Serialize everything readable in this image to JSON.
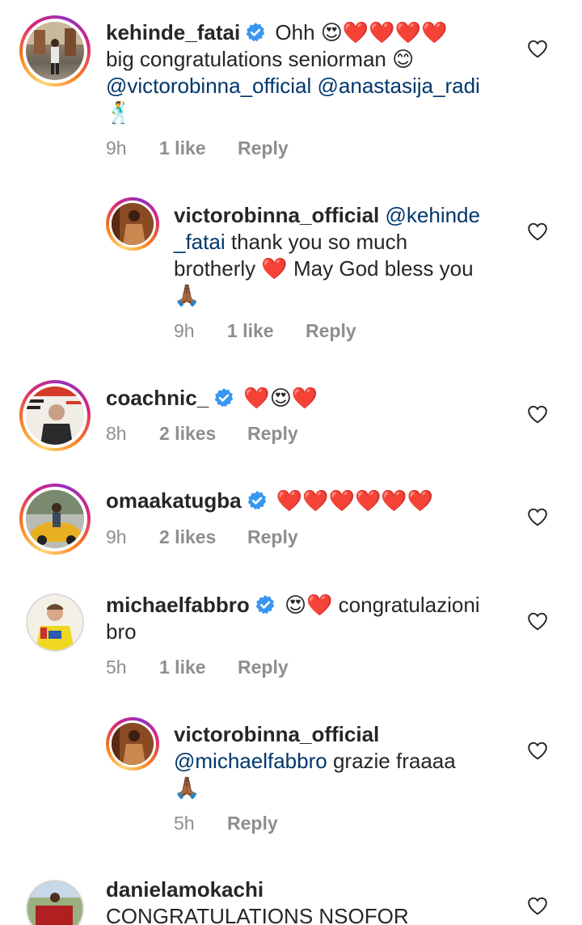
{
  "comments": [
    {
      "username": "kehinde_fatai",
      "verified": true,
      "text_a": "Ohh",
      "emojis_a": "😍❤️❤️❤️❤️",
      "text_b": "big congratulations seniorman",
      "emoji_b": "😊",
      "mention_1": "@victorobinna_official",
      "mention_2": "@anastasija_radi",
      "emoji_c": "🕺",
      "time": "9h",
      "likes": "1 like",
      "reply": "Reply"
    },
    {
      "username": "victorobinna_official",
      "mention_a": "@kehinde",
      "mention_b": "_fatai",
      "text_a": "thank you so much",
      "text_b": "brotherly",
      "heart": "❤️",
      "text_c": "May God bless you",
      "emoji": "🙏🏾",
      "time": "9h",
      "likes": "1 like",
      "reply": "Reply"
    },
    {
      "username": "coachnic_",
      "verified": true,
      "emojis": "❤️😍❤️",
      "time": "8h",
      "likes": "2 likes",
      "reply": "Reply"
    },
    {
      "username": "omaakatugba",
      "verified": true,
      "emojis": "❤️❤️❤️❤️❤️❤️",
      "time": "9h",
      "likes": "2 likes",
      "reply": "Reply"
    },
    {
      "username": "michaelfabbro",
      "verified": true,
      "emojis": "😍❤️",
      "text_a": "congratulazioni",
      "text_b": "bro",
      "time": "5h",
      "likes": "1 like",
      "reply": "Reply"
    },
    {
      "username": "victorobinna_official",
      "mention": "@michaelfabbro",
      "text_a": "grazie fraaaa",
      "emoji": "🙏🏾",
      "time": "5h",
      "reply": "Reply"
    },
    {
      "username": "danielamokachi",
      "text_a": "CONGRATULATIONS NSOFOR"
    }
  ],
  "colors": {
    "verified": "#3897f0",
    "mention": "#00376b",
    "meta": "#8e8e8e"
  },
  "icons": {
    "like": "heart-outline-icon",
    "verified": "verified-badge-icon"
  }
}
